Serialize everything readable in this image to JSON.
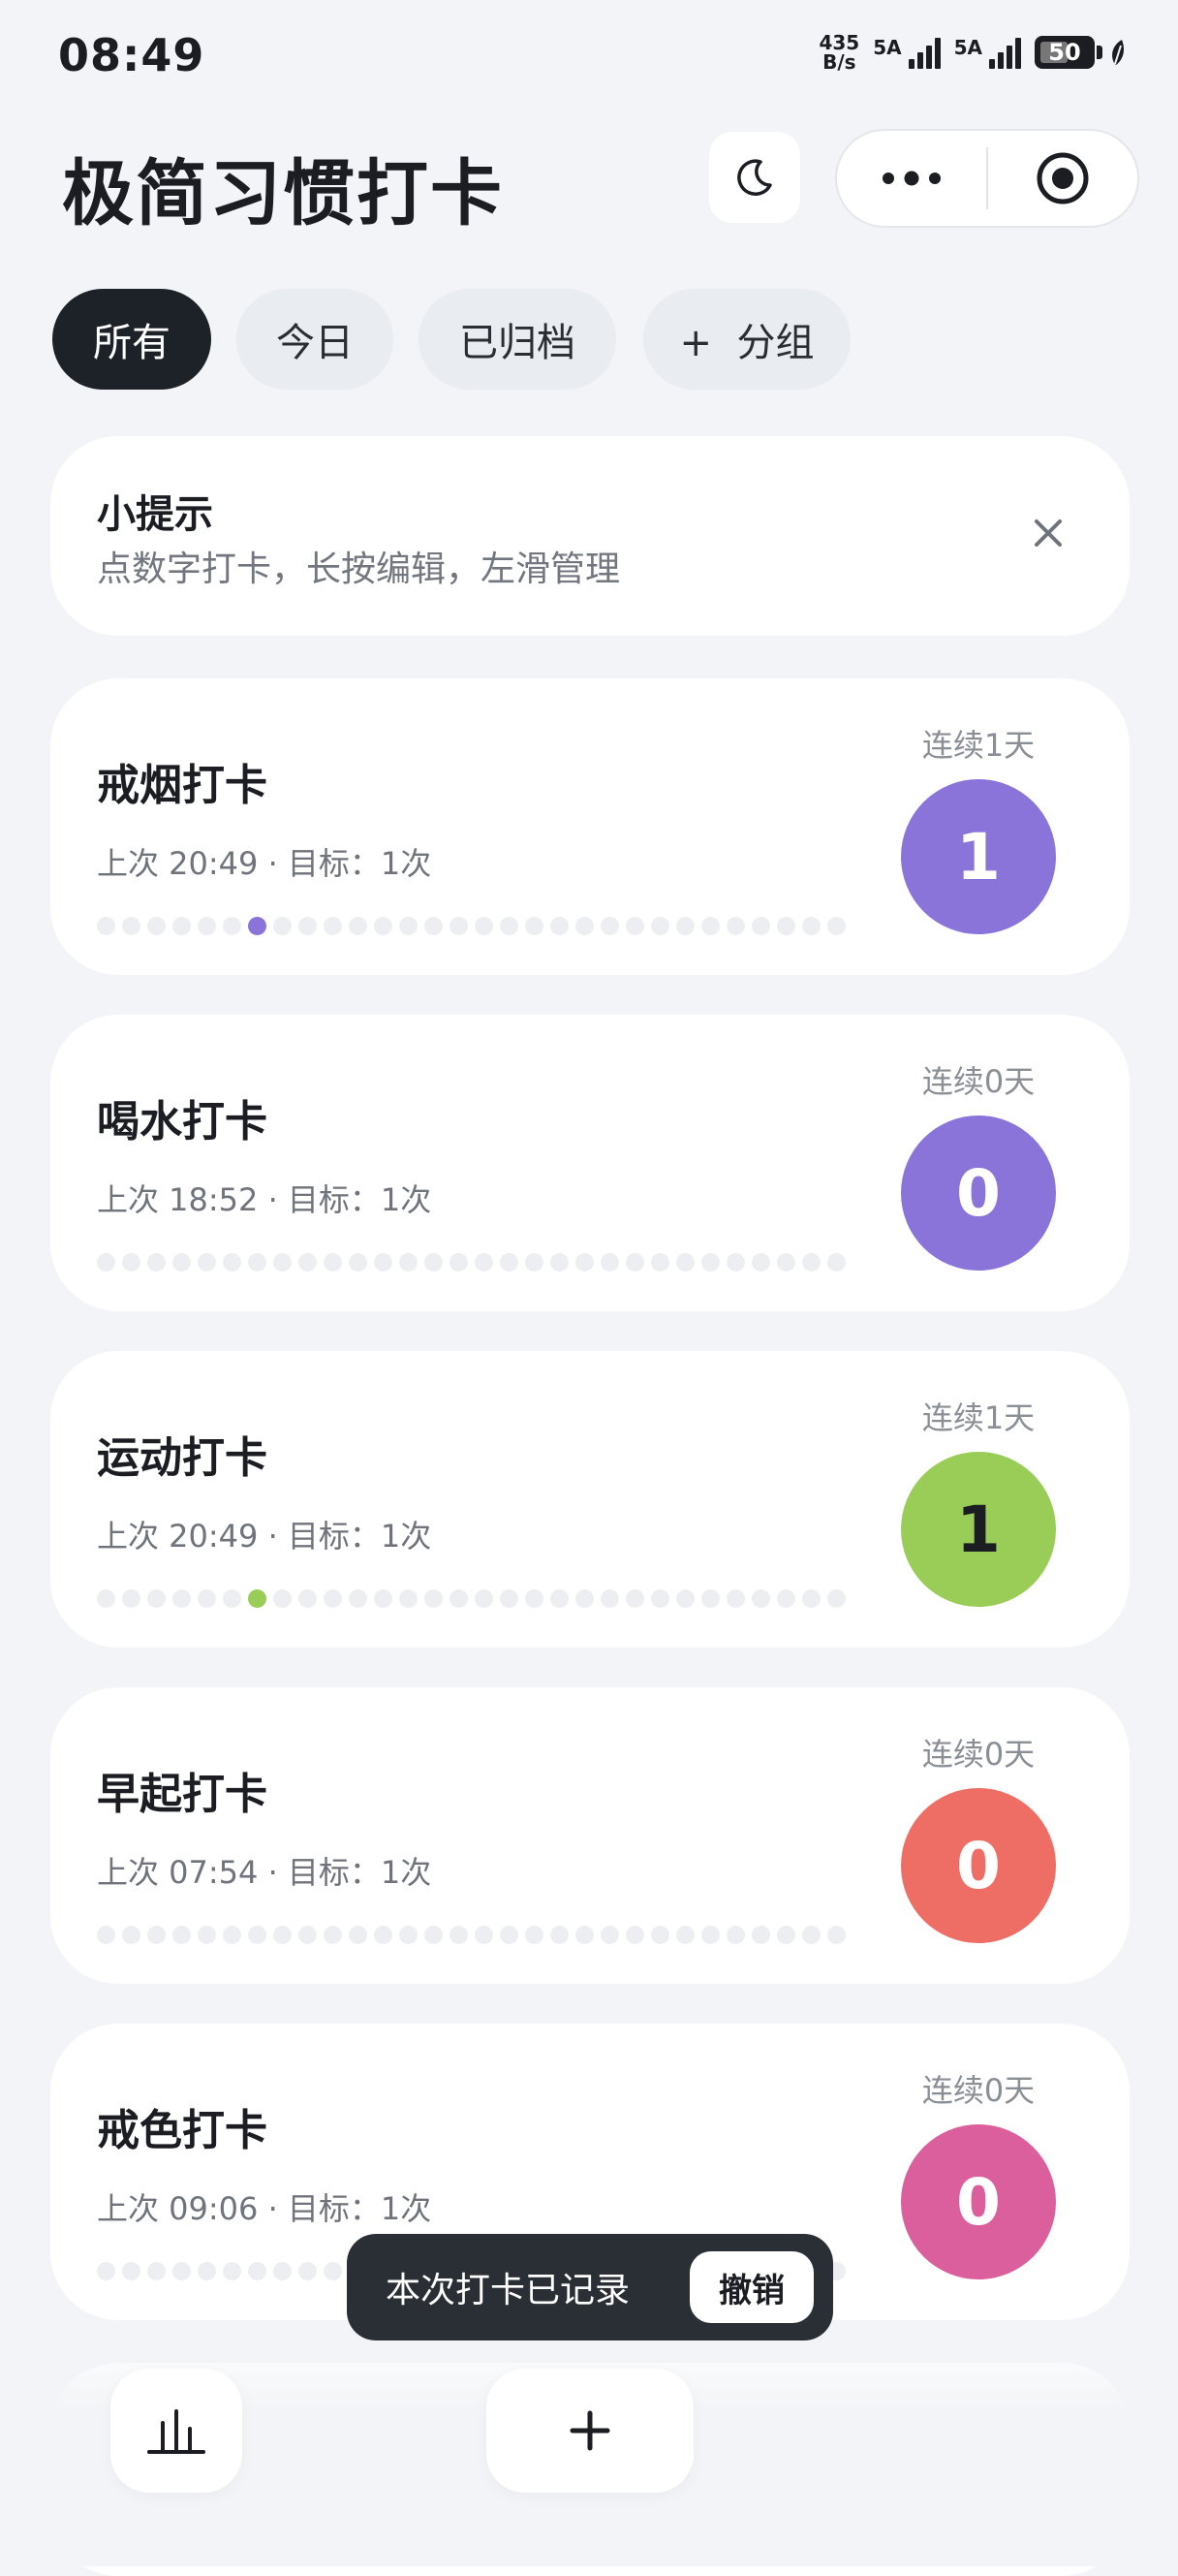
{
  "status_bar": {
    "time": "08:49",
    "net_speed_value": "435",
    "net_speed_unit": "B/s",
    "signal1_label": "5A",
    "signal2_label": "5A",
    "battery": "50"
  },
  "header": {
    "title": "极简习惯打卡",
    "theme_icon": "moon-icon",
    "more_icon": "more-dots-icon",
    "record_icon": "target-icon"
  },
  "tabs": [
    {
      "label": "所有",
      "active": true
    },
    {
      "label": "今日",
      "active": false
    },
    {
      "label": "已归档",
      "active": false
    },
    {
      "label": "+  分组",
      "active": false
    }
  ],
  "tip": {
    "title": "小提示",
    "text": "点数字打卡，长按编辑，左滑管理"
  },
  "habits": [
    {
      "name": "戒烟打卡",
      "meta": "上次 20:49 · 目标：1次",
      "streak": "连续1天",
      "count": "1",
      "color": "#8b74d9",
      "filled_dot": 6
    },
    {
      "name": "喝水打卡",
      "meta": "上次 18:52 · 目标：1次",
      "streak": "连续0天",
      "count": "0",
      "color": "#8b74d9",
      "filled_dot": -1
    },
    {
      "name": "运动打卡",
      "meta": "上次 20:49 · 目标：1次",
      "streak": "连续1天",
      "count": "1",
      "color": "#9acd58",
      "filled_dot": 6
    },
    {
      "name": "早起打卡",
      "meta": "上次 07:54 · 目标：1次",
      "streak": "连续0天",
      "count": "0",
      "color": "#ee6e66",
      "filled_dot": -1
    },
    {
      "name": "戒色打卡",
      "meta": "上次 09:06 · 目标：1次",
      "streak": "连续0天",
      "count": "0",
      "color": "#da5f9c",
      "filled_dot": -1
    }
  ],
  "toast": {
    "text": "本次打卡已记录",
    "action": "撤销"
  },
  "bottom_bar": {
    "stats_icon": "bar-chart-icon",
    "add_icon": "plus-icon"
  }
}
